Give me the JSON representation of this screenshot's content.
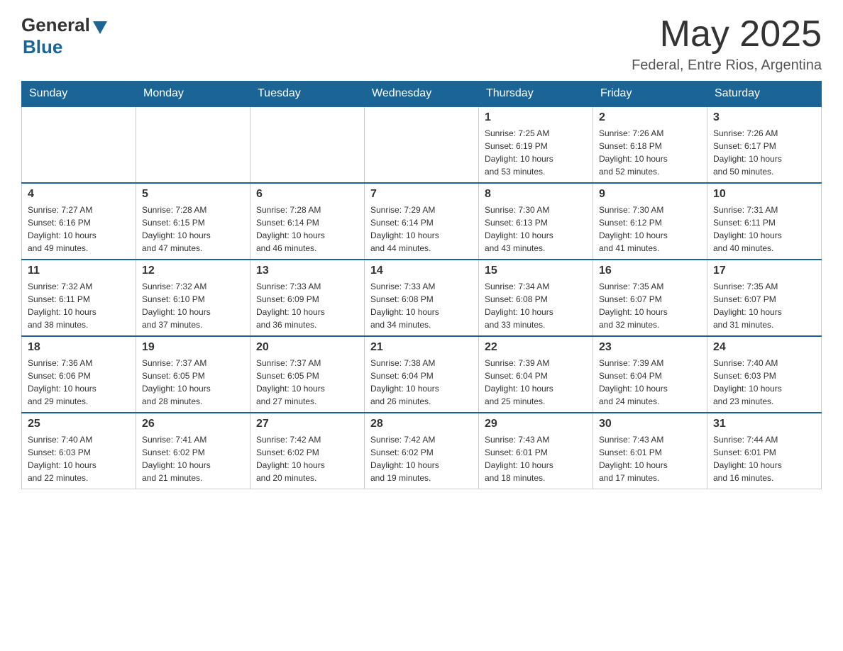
{
  "logo": {
    "general": "General",
    "blue": "Blue"
  },
  "header": {
    "month_year": "May 2025",
    "location": "Federal, Entre Rios, Argentina"
  },
  "weekdays": [
    "Sunday",
    "Monday",
    "Tuesday",
    "Wednesday",
    "Thursday",
    "Friday",
    "Saturday"
  ],
  "weeks": [
    [
      {
        "day": "",
        "info": ""
      },
      {
        "day": "",
        "info": ""
      },
      {
        "day": "",
        "info": ""
      },
      {
        "day": "",
        "info": ""
      },
      {
        "day": "1",
        "info": "Sunrise: 7:25 AM\nSunset: 6:19 PM\nDaylight: 10 hours\nand 53 minutes."
      },
      {
        "day": "2",
        "info": "Sunrise: 7:26 AM\nSunset: 6:18 PM\nDaylight: 10 hours\nand 52 minutes."
      },
      {
        "day": "3",
        "info": "Sunrise: 7:26 AM\nSunset: 6:17 PM\nDaylight: 10 hours\nand 50 minutes."
      }
    ],
    [
      {
        "day": "4",
        "info": "Sunrise: 7:27 AM\nSunset: 6:16 PM\nDaylight: 10 hours\nand 49 minutes."
      },
      {
        "day": "5",
        "info": "Sunrise: 7:28 AM\nSunset: 6:15 PM\nDaylight: 10 hours\nand 47 minutes."
      },
      {
        "day": "6",
        "info": "Sunrise: 7:28 AM\nSunset: 6:14 PM\nDaylight: 10 hours\nand 46 minutes."
      },
      {
        "day": "7",
        "info": "Sunrise: 7:29 AM\nSunset: 6:14 PM\nDaylight: 10 hours\nand 44 minutes."
      },
      {
        "day": "8",
        "info": "Sunrise: 7:30 AM\nSunset: 6:13 PM\nDaylight: 10 hours\nand 43 minutes."
      },
      {
        "day": "9",
        "info": "Sunrise: 7:30 AM\nSunset: 6:12 PM\nDaylight: 10 hours\nand 41 minutes."
      },
      {
        "day": "10",
        "info": "Sunrise: 7:31 AM\nSunset: 6:11 PM\nDaylight: 10 hours\nand 40 minutes."
      }
    ],
    [
      {
        "day": "11",
        "info": "Sunrise: 7:32 AM\nSunset: 6:11 PM\nDaylight: 10 hours\nand 38 minutes."
      },
      {
        "day": "12",
        "info": "Sunrise: 7:32 AM\nSunset: 6:10 PM\nDaylight: 10 hours\nand 37 minutes."
      },
      {
        "day": "13",
        "info": "Sunrise: 7:33 AM\nSunset: 6:09 PM\nDaylight: 10 hours\nand 36 minutes."
      },
      {
        "day": "14",
        "info": "Sunrise: 7:33 AM\nSunset: 6:08 PM\nDaylight: 10 hours\nand 34 minutes."
      },
      {
        "day": "15",
        "info": "Sunrise: 7:34 AM\nSunset: 6:08 PM\nDaylight: 10 hours\nand 33 minutes."
      },
      {
        "day": "16",
        "info": "Sunrise: 7:35 AM\nSunset: 6:07 PM\nDaylight: 10 hours\nand 32 minutes."
      },
      {
        "day": "17",
        "info": "Sunrise: 7:35 AM\nSunset: 6:07 PM\nDaylight: 10 hours\nand 31 minutes."
      }
    ],
    [
      {
        "day": "18",
        "info": "Sunrise: 7:36 AM\nSunset: 6:06 PM\nDaylight: 10 hours\nand 29 minutes."
      },
      {
        "day": "19",
        "info": "Sunrise: 7:37 AM\nSunset: 6:05 PM\nDaylight: 10 hours\nand 28 minutes."
      },
      {
        "day": "20",
        "info": "Sunrise: 7:37 AM\nSunset: 6:05 PM\nDaylight: 10 hours\nand 27 minutes."
      },
      {
        "day": "21",
        "info": "Sunrise: 7:38 AM\nSunset: 6:04 PM\nDaylight: 10 hours\nand 26 minutes."
      },
      {
        "day": "22",
        "info": "Sunrise: 7:39 AM\nSunset: 6:04 PM\nDaylight: 10 hours\nand 25 minutes."
      },
      {
        "day": "23",
        "info": "Sunrise: 7:39 AM\nSunset: 6:04 PM\nDaylight: 10 hours\nand 24 minutes."
      },
      {
        "day": "24",
        "info": "Sunrise: 7:40 AM\nSunset: 6:03 PM\nDaylight: 10 hours\nand 23 minutes."
      }
    ],
    [
      {
        "day": "25",
        "info": "Sunrise: 7:40 AM\nSunset: 6:03 PM\nDaylight: 10 hours\nand 22 minutes."
      },
      {
        "day": "26",
        "info": "Sunrise: 7:41 AM\nSunset: 6:02 PM\nDaylight: 10 hours\nand 21 minutes."
      },
      {
        "day": "27",
        "info": "Sunrise: 7:42 AM\nSunset: 6:02 PM\nDaylight: 10 hours\nand 20 minutes."
      },
      {
        "day": "28",
        "info": "Sunrise: 7:42 AM\nSunset: 6:02 PM\nDaylight: 10 hours\nand 19 minutes."
      },
      {
        "day": "29",
        "info": "Sunrise: 7:43 AM\nSunset: 6:01 PM\nDaylight: 10 hours\nand 18 minutes."
      },
      {
        "day": "30",
        "info": "Sunrise: 7:43 AM\nSunset: 6:01 PM\nDaylight: 10 hours\nand 17 minutes."
      },
      {
        "day": "31",
        "info": "Sunrise: 7:44 AM\nSunset: 6:01 PM\nDaylight: 10 hours\nand 16 minutes."
      }
    ]
  ]
}
